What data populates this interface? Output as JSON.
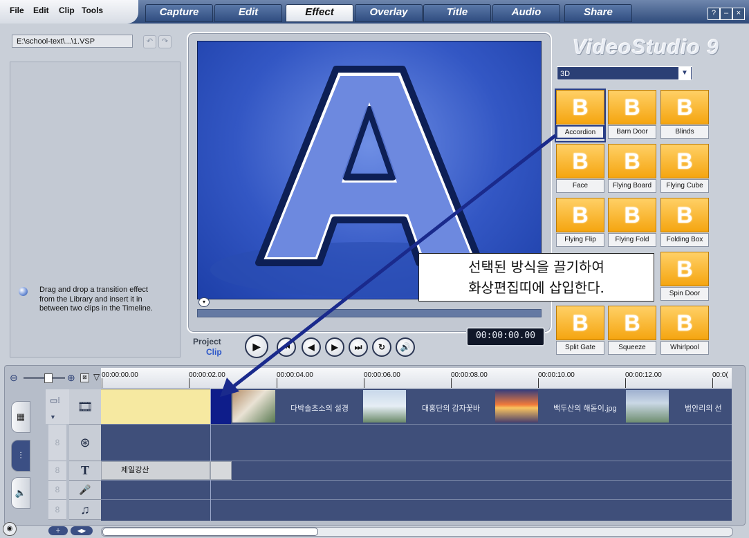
{
  "menu": [
    "File",
    "Edit",
    "Clip",
    "Tools"
  ],
  "tabs": [
    "Capture",
    "Edit",
    "Effect",
    "Overlay",
    "Title",
    "Audio",
    "Share"
  ],
  "window_buttons": [
    "?",
    "–",
    "×"
  ],
  "project_path": "E:\\school-text\\...\\1.VSP",
  "hint_text": "Drag and drop a transition effect from the Library and insert it in between two clips in the Timeline.",
  "brand": "VideoStudio 9",
  "library": {
    "category": "3D",
    "items": [
      "Accordion",
      "Barn Door",
      "Blinds",
      "Face",
      "Flying Board",
      "Flying Cube",
      "Flying Flip",
      "Flying Fold",
      "Folding Box",
      "Spin Door",
      "Split Gate",
      "Squeeze",
      "Whirlpool"
    ],
    "thumb_letter": "B"
  },
  "preview": {
    "big_letter": "A"
  },
  "player": {
    "project_label": "Project",
    "clip_label": "Clip",
    "timecode": "00:00:00.00"
  },
  "annotation": {
    "line1": "선택된 방식을 끌기하여",
    "line2": "화상편집띠에 삽입한다."
  },
  "timeline": {
    "ticks": [
      "00:00:00.00",
      "00:00:02.00",
      "00:00:04.00",
      "00:00:06.00",
      "00:00:08.00",
      "00:00:10.00",
      "00:00:12.00",
      "00:0("
    ],
    "clips": [
      "다박솔초소의 설경",
      "대홍단의 감자꽃바",
      "백두산의 해돋이.jpg",
      "범안리의 선"
    ],
    "title_clip": "제일강산"
  },
  "colors": {
    "accent": "#2b3f75",
    "library_thumb": "#f5a510",
    "arrow": "#1a2a8c"
  }
}
